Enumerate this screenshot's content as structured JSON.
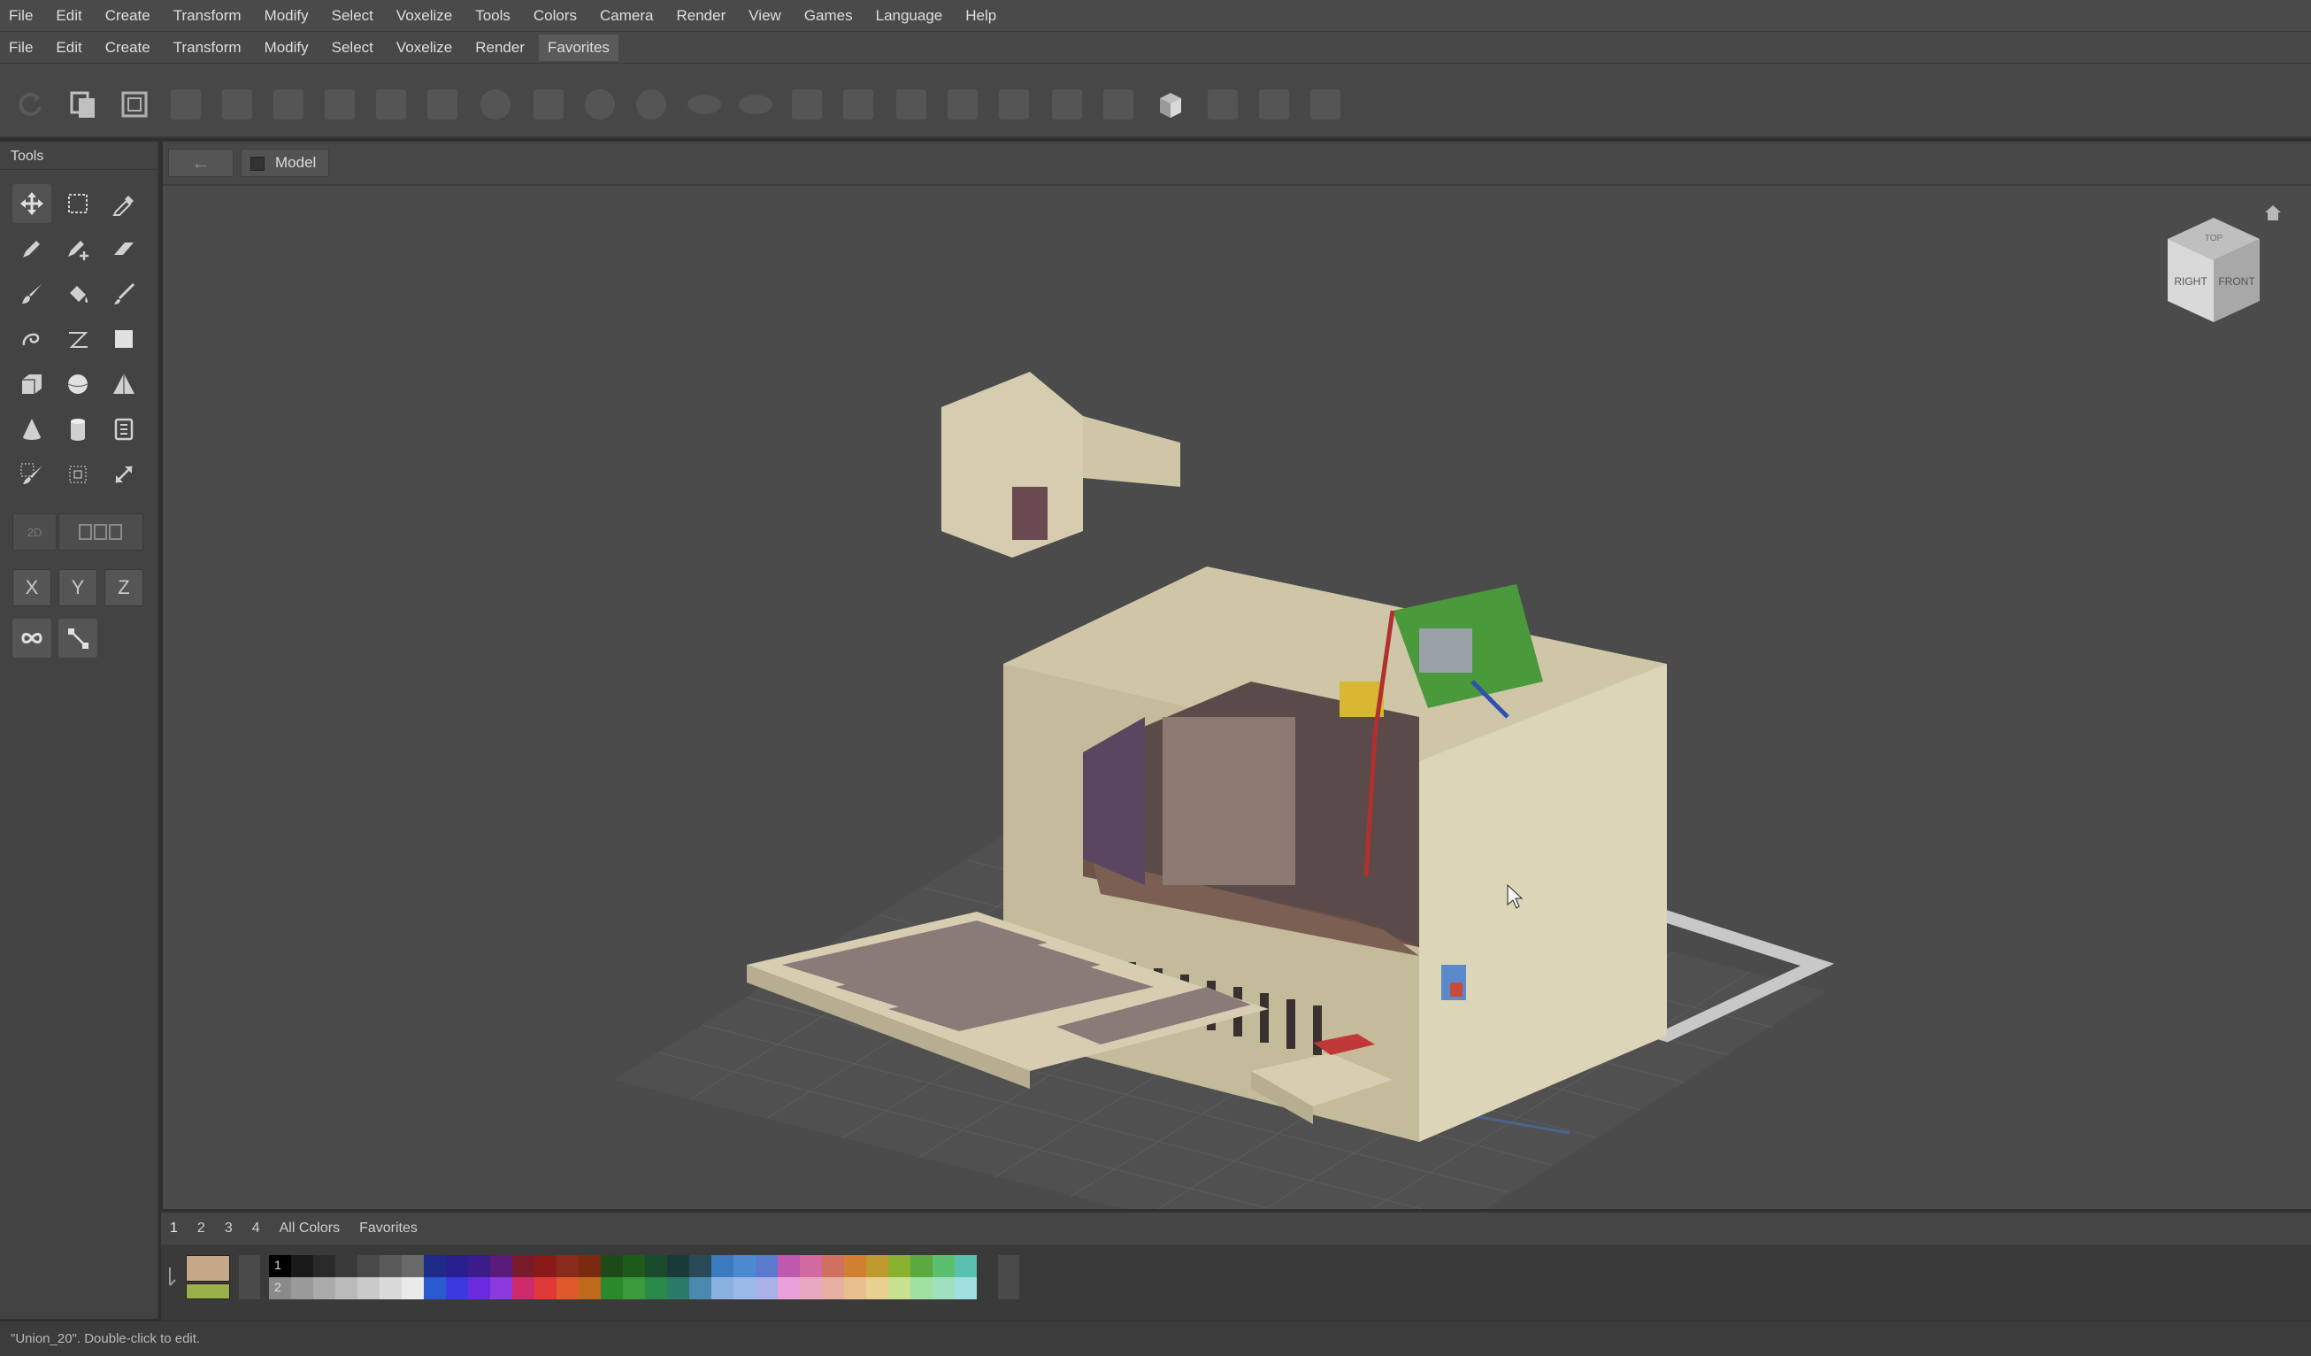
{
  "menubar": {
    "items": [
      "File",
      "Edit",
      "Create",
      "Transform",
      "Modify",
      "Select",
      "Voxelize",
      "Tools",
      "Colors",
      "Camera",
      "Render",
      "View",
      "Games",
      "Language",
      "Help"
    ]
  },
  "submenubar": {
    "items": [
      "File",
      "Edit",
      "Create",
      "Transform",
      "Modify",
      "Select",
      "Voxelize",
      "Render",
      "Favorites"
    ],
    "active": "Favorites"
  },
  "tools_panel": {
    "title": "Tools",
    "axis_x": "X",
    "axis_y": "Y",
    "axis_z": "Z",
    "mode_2d": "2D"
  },
  "viewport": {
    "back_label": "←",
    "tab_label": "Model"
  },
  "navcube": {
    "top_label": "TOP",
    "right_label": "RIGHT",
    "front_label": "FRONT"
  },
  "palette": {
    "tabs": [
      "1",
      "2",
      "3",
      "4",
      "All Colors",
      "Favorites"
    ],
    "active_tab": "1",
    "row_numbers": [
      "1",
      "2"
    ],
    "row1": [
      "#000000",
      "#1a1a1a",
      "#2a2a2a",
      "#3a3a3a",
      "#4a4a4a",
      "#5a5a5a",
      "#6a6a6a",
      "#1e2a8a",
      "#2a1f8f",
      "#3a1d8a",
      "#5a1a7a",
      "#7a1a2a",
      "#8a1a1a",
      "#8a2a1a",
      "#7a2a10",
      "#1e4a1a",
      "#1e5a1a",
      "#1a4a2a",
      "#1a3a3a",
      "#2a4a5a",
      "#3a7abf",
      "#4a8acf",
      "#5a7acf",
      "#c05ab0",
      "#d06aa0",
      "#d07060",
      "#d08030",
      "#c09a30",
      "#8ab030",
      "#5aaa40",
      "#5ac070",
      "#5ac0b0"
    ],
    "row2": [
      "#8a8a8a",
      "#9a9a9a",
      "#aaaaaa",
      "#bababa",
      "#cacaca",
      "#dadada",
      "#eaeaea",
      "#2a5acf",
      "#3a3adf",
      "#6a2adf",
      "#8a3adf",
      "#cf2a6a",
      "#df3a3a",
      "#df5a2a",
      "#bf6a1a",
      "#2a8a2a",
      "#3a9a3a",
      "#2a8a4a",
      "#2a7a6a",
      "#4a8aaf",
      "#8ab0df",
      "#9ab8e8",
      "#aab0e8",
      "#e8a0d8",
      "#e8a8c0",
      "#e8b0a0",
      "#e8c090",
      "#e8d090",
      "#c8e090",
      "#a0e0a0",
      "#a0e0c0",
      "#a0e0e0"
    ],
    "current_primary": "#c4a888",
    "current_secondary": "#9ab04a"
  },
  "status": {
    "text": "\"Union_20\". Double-click to edit."
  }
}
